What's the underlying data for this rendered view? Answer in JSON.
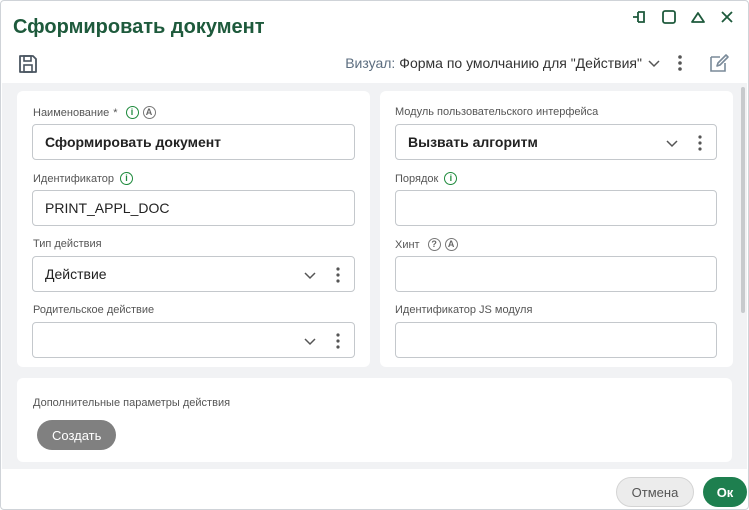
{
  "dialog": {
    "title": "Сформировать документ"
  },
  "toolbar": {
    "visual_label": "Визуал:",
    "visual_value": "Форма по умолчанию для \"Действия\""
  },
  "left": {
    "name": {
      "label": "Наименование",
      "required_mark": "*",
      "value": "Сформировать документ"
    },
    "identifier": {
      "label": "Идентификатор",
      "value": "PRINT_APPL_DOC"
    },
    "action_type": {
      "label": "Тип действия",
      "value": "Действие"
    },
    "parent_action": {
      "label": "Родительское действие",
      "value": ""
    }
  },
  "right": {
    "ui_module": {
      "label": "Модуль пользовательского интерфейса",
      "value": "Вызвать алгоритм"
    },
    "order": {
      "label": "Порядок",
      "value": ""
    },
    "hint": {
      "label": "Хинт",
      "value": ""
    },
    "js_module": {
      "label": "Идентификатор JS модуля",
      "value": ""
    }
  },
  "extra": {
    "label": "Дополнительные параметры действия",
    "create_label": "Создать"
  },
  "footer": {
    "cancel_label": "Отмена",
    "ok_label": "Ок"
  },
  "icons": {
    "info": "i",
    "auto": "A",
    "help": "?"
  },
  "colors": {
    "title": "#1e5a3c",
    "ok_button": "#1e7f4f",
    "info_icon": "#1e8a3c",
    "create_button": "#808080"
  }
}
